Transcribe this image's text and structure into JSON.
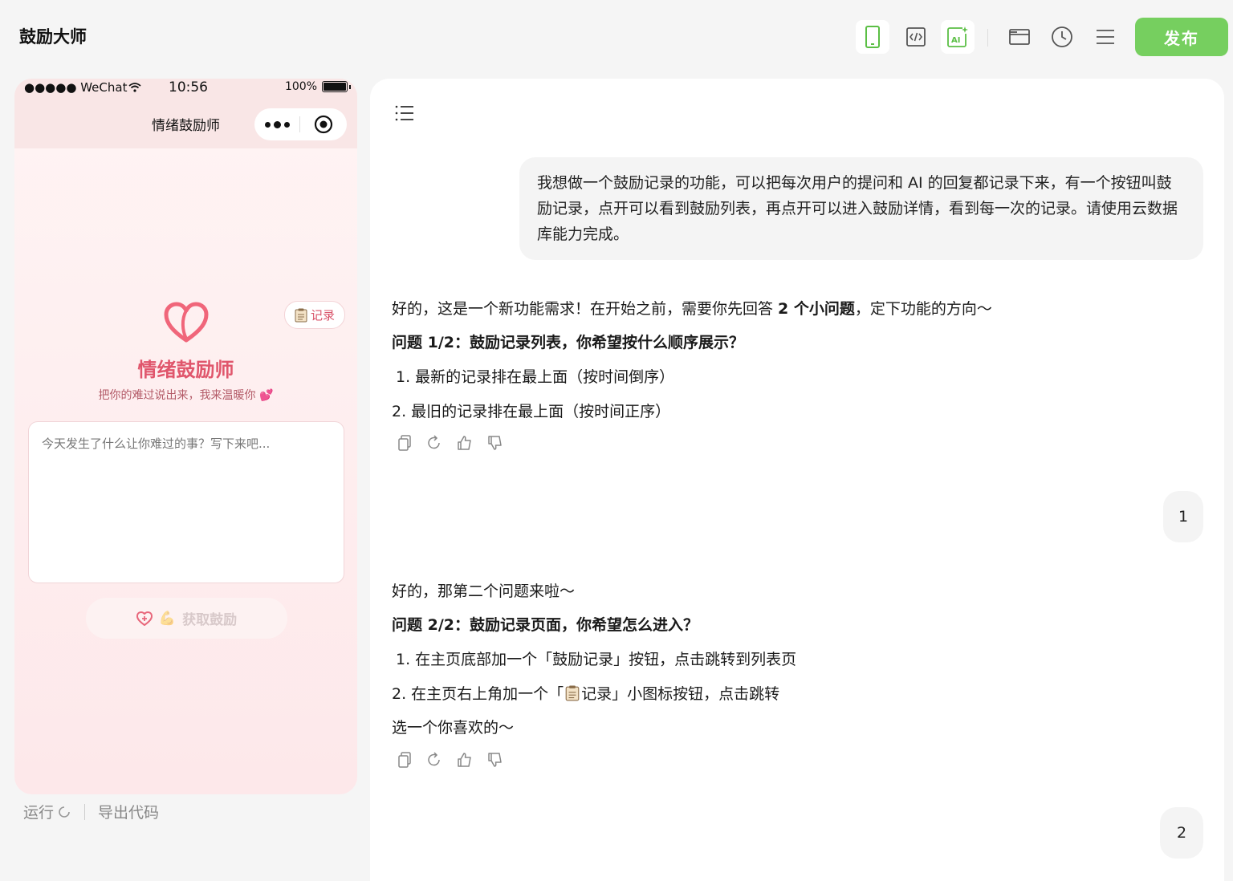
{
  "app": {
    "title": "鼓励大师",
    "publish_label": "发布"
  },
  "toolbar": {
    "icons": [
      "phone-preview-icon",
      "code-icon",
      "ai-icon",
      "folder-icon",
      "history-icon",
      "menu-icon"
    ]
  },
  "phone": {
    "status": {
      "carrier": "●●●●● WeChat",
      "time": "10:56",
      "battery": "100%"
    },
    "mp_title": "情绪鼓励师",
    "record_label": "记录",
    "app_name": "情绪鼓励师",
    "subtitle": "把你的难过说出来，我来温暖你",
    "placeholder": "今天发生了什么让你难过的事？写下来吧...",
    "get_button": "获取鼓励"
  },
  "footer": {
    "run_label": "运行",
    "export_label": "导出代码"
  },
  "chat": {
    "user_msg_1": "我想做一个鼓励记录的功能，可以把每次用户的提问和 AI 的回复都记录下来，有一个按钮叫鼓励记录，点开可以看到鼓励列表，再点开可以进入鼓励详情，看到每一次的记录。请使用云数据库能力完成。",
    "ai1": {
      "intro_a": "好的，这是一个新功能需求！在开始之前，需要你先回答 ",
      "intro_b": "2 个小问题",
      "intro_c": "，定下功能的方向～",
      "question": "问题 1/2：鼓励记录列表，你希望按什么顺序展示？",
      "option1": "1. 最新的记录排在最上面（按时间倒序）",
      "option2": "2. 最旧的记录排在最上面（按时间正序）"
    },
    "user_msg_2": "1",
    "ai2": {
      "intro": "好的，那第二个问题来啦～",
      "question": "问题 2/2：鼓励记录页面，你希望怎么进入？",
      "option1": "1. 在主页底部加一个「鼓励记录」按钮，点击跳转到列表页",
      "option2_a": "2. 在主页右上角加一个「",
      "option2_b": " 记录」小图标按钮，点击跳转",
      "closing": "选一个你喜欢的～"
    },
    "user_msg_3": "2"
  },
  "colors": {
    "accent": "#76cf5f",
    "brand_pink": "#e0566c"
  }
}
